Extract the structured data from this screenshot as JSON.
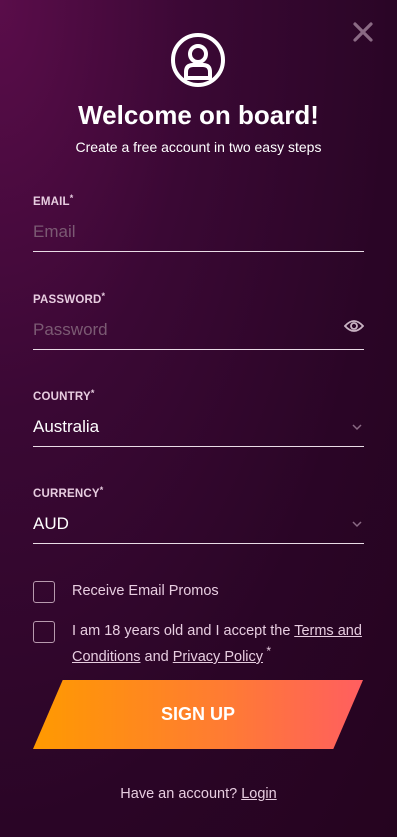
{
  "header": {
    "title": "Welcome on board!",
    "subtitle": "Create a free account in two easy steps",
    "close_icon": "close-icon",
    "avatar_icon": "user-avatar-icon"
  },
  "form": {
    "email": {
      "label": "EMAIL",
      "required": "*",
      "placeholder": "Email",
      "value": ""
    },
    "password": {
      "label": "PASSWORD",
      "required": "*",
      "placeholder": "Password",
      "value": "",
      "toggle_icon": "eye-icon"
    },
    "country": {
      "label": "COUNTRY",
      "required": "*",
      "value": "Australia"
    },
    "currency": {
      "label": "CURRENCY",
      "required": "*",
      "value": "AUD"
    }
  },
  "checkboxes": {
    "promos": {
      "label": "Receive Email Promos",
      "checked": false
    },
    "terms": {
      "prefix": "I am 18 years old and I accept the ",
      "terms_link": "Terms and Conditions",
      "middle": " and ",
      "privacy_link": "Privacy Policy",
      "required": " *",
      "checked": false
    }
  },
  "signup_button": "SIGN UP",
  "footer": {
    "prompt": "Have an account? ",
    "login_link": "Login"
  },
  "colors": {
    "background": "#2a0526",
    "accent_start": "#ff9a00",
    "accent_end": "#ff5e60",
    "label": "#e7cde0"
  }
}
